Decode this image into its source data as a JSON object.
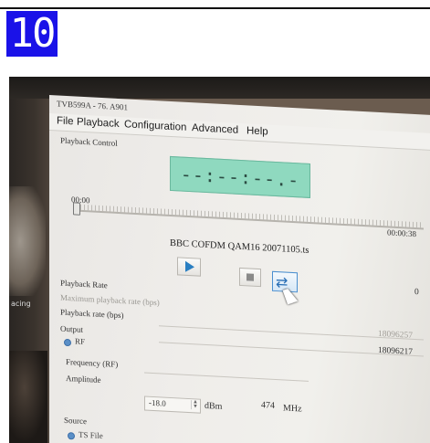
{
  "step_badge": "10",
  "window": {
    "title": "TVB599A - 76. A901"
  },
  "menu": [
    "File",
    "Playback",
    "Configuration",
    "Advanced",
    "Help"
  ],
  "left_edge_label": "acing",
  "playback_control": {
    "label": "Playback Control",
    "timecode": "--:--:--.-",
    "time_start": "00:00",
    "time_end": "00:00:38",
    "position_fraction": 0.0,
    "filename": "BBC COFDM QAM16 20071105.ts"
  },
  "playback_rate": {
    "label": "Playback Rate",
    "max_label": "Maximum playback rate (bps)",
    "rate_label": "Playback rate (bps)",
    "value_partial": "0"
  },
  "output": {
    "label": "Output",
    "max_value": "18096257",
    "rate_value": "18096217",
    "rf_label": "RF",
    "frequency_label": "Frequency (RF)",
    "frequency_value": "474",
    "frequency_unit": "MHz",
    "amplitude_label": "Amplitude",
    "amplitude_value": "-18.0",
    "amplitude_unit": "dBm"
  },
  "source": {
    "label": "Source",
    "ts_file_label": "TS File"
  },
  "colors": {
    "badge": "#1a12e8",
    "timecode_bg": "#8fd9bf",
    "accent_blue": "#2a7fc2"
  }
}
